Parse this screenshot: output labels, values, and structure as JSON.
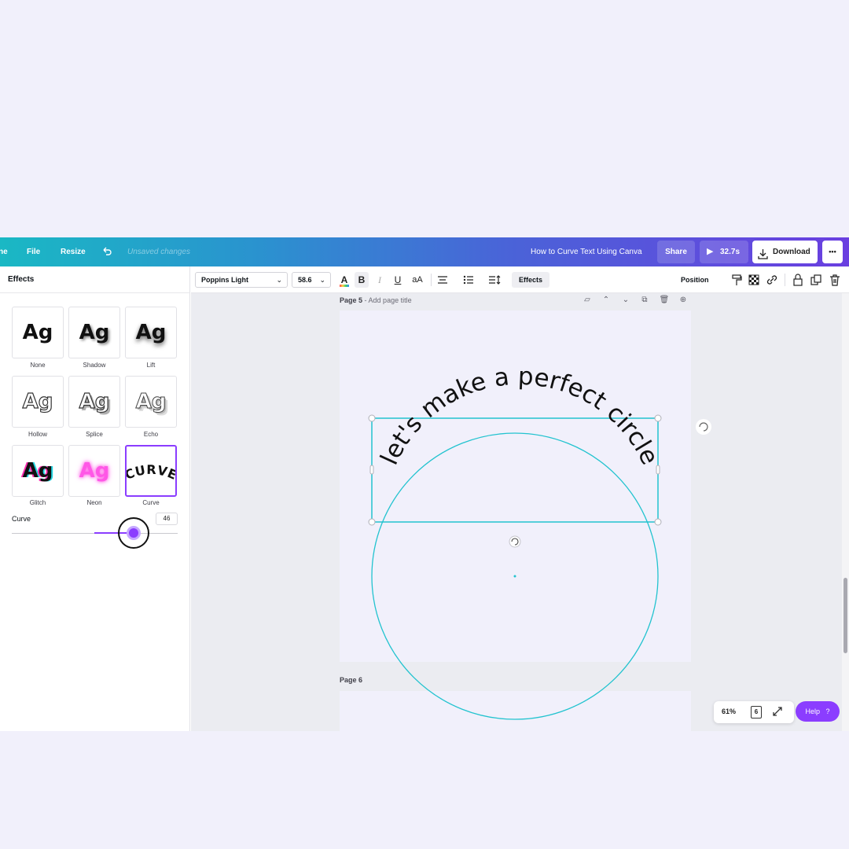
{
  "topbar": {
    "home_partial": "ne",
    "file": "File",
    "resize": "Resize",
    "undo_icon": "undo-icon",
    "unsaved": "Unsaved changes",
    "design_title": "How to Curve Text Using Canva",
    "share": "Share",
    "play_duration": "32.7s",
    "download": "Download",
    "more": "•••"
  },
  "effects_panel": {
    "title": "Effects",
    "tiles": [
      {
        "sample": "Ag",
        "label": "None"
      },
      {
        "sample": "Ag",
        "label": "Shadow"
      },
      {
        "sample": "Ag",
        "label": "Lift"
      },
      {
        "sample": "Ag",
        "label": "Hollow"
      },
      {
        "sample": "Ag",
        "label": "Splice"
      },
      {
        "sample": "Ag",
        "label": "Echo"
      },
      {
        "sample": "Ag",
        "label": "Glitch"
      },
      {
        "sample": "Ag",
        "label": "Neon"
      },
      {
        "sample": "CURVE",
        "label": "Curve"
      }
    ],
    "selected": "Curve",
    "curve_label": "Curve",
    "curve_value": "46",
    "curve_fraction": 0.73
  },
  "toolbar": {
    "font": "Poppins Light",
    "font_size": "58.6",
    "effects": "Effects",
    "position": "Position"
  },
  "canvas": {
    "page5_number": "Page 5",
    "page5_placeholder": "- Add page title",
    "page6_label": "Page 6",
    "curved_text": "let's make a perfect circle",
    "zoom": "61%",
    "page_count": "6",
    "help": "Help",
    "help_icon": "?"
  },
  "colors": {
    "accent": "#8b3dff",
    "selection": "#22c3cf",
    "page_bg": "#f1f0fb"
  }
}
